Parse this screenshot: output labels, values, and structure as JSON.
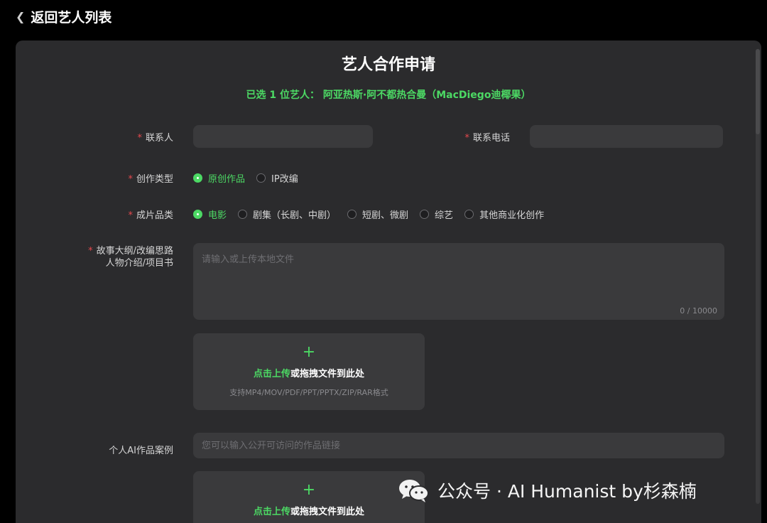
{
  "nav": {
    "back_label": "返回艺人列表"
  },
  "form": {
    "title": "艺人合作申请",
    "selected_artist": "已选 1 位艺人： 阿亚热斯·阿不都热合曼（MacDiego迪椰果）",
    "contact_label": "联系人",
    "phone_label": "联系电话",
    "contact_value": "",
    "phone_value": "",
    "creation_type_label": "创作类型",
    "creation_types": [
      {
        "label": "原创作品",
        "checked": true
      },
      {
        "label": "IP改编",
        "checked": false
      }
    ],
    "category_label": "成片品类",
    "categories": [
      {
        "label": "电影",
        "checked": true
      },
      {
        "label": "剧集（长剧、中剧）",
        "checked": false
      },
      {
        "label": "短剧、微剧",
        "checked": false
      },
      {
        "label": "综艺",
        "checked": false
      },
      {
        "label": "其他商业化创作",
        "checked": false
      }
    ],
    "outline_label_line1": "故事大纲/改编思路",
    "outline_label_line2": "人物介绍/项目书",
    "outline_placeholder": "请输入或上传本地文件",
    "outline_counter": "0 / 10000",
    "upload": {
      "click_text": "点击上传",
      "drag_text": "或拖拽文件到此处",
      "formats": "支持MP4/MOV/PDF/PPT/PPTX/ZIP/RAR格式"
    },
    "ai_works_label": "个人AI作品案例",
    "ai_works_placeholder": "您可以输入公开可访问的作品链接"
  },
  "watermark": {
    "text": "公众号 · AI Humanist by杉森楠"
  },
  "colors": {
    "accent": "#4cd964",
    "required": "#e5484d",
    "panel": "#2b2b2d",
    "field": "#3a3a3c"
  }
}
